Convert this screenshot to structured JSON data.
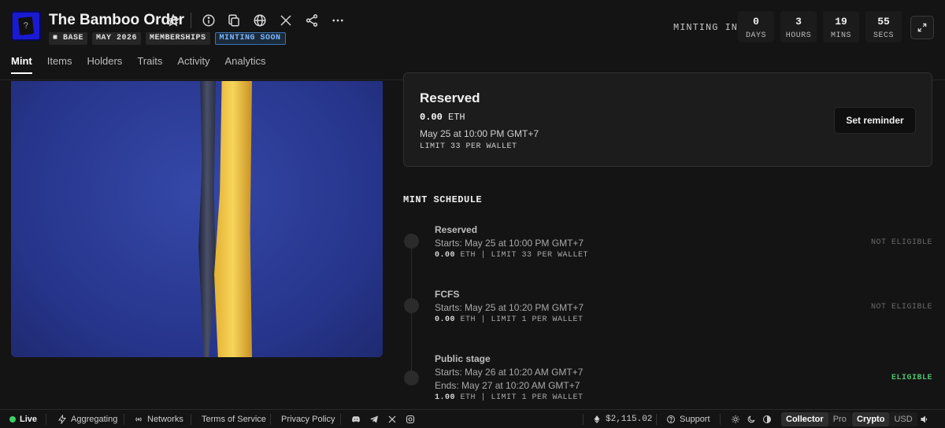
{
  "collection": {
    "title": "The Bamboo Order",
    "logo_glyph": "?",
    "badges": [
      {
        "label": "■ BASE"
      },
      {
        "label": "MAY 2026"
      },
      {
        "label": "MEMBERSHIPS"
      },
      {
        "label": "MINTING SOON"
      }
    ]
  },
  "header_icons": [
    "star-icon",
    "info-icon",
    "copy-icon",
    "globe-icon",
    "x-icon",
    "share-icon",
    "more-icon"
  ],
  "countdown": {
    "label": "MINTING IN",
    "units": [
      {
        "value": "0",
        "label": "DAYS"
      },
      {
        "value": "3",
        "label": "HOURS"
      },
      {
        "value": "19",
        "label": "MINS"
      },
      {
        "value": "55",
        "label": "SECS"
      }
    ]
  },
  "tabs": [
    {
      "label": "Mint",
      "active": true
    },
    {
      "label": "Items"
    },
    {
      "label": "Holders"
    },
    {
      "label": "Traits"
    },
    {
      "label": "Activity"
    },
    {
      "label": "Analytics"
    }
  ],
  "current_stage": {
    "title": "Reserved",
    "price": "0.00",
    "currency": "ETH",
    "date": "May 25 at 10:00 PM GMT+7",
    "limit": "LIMIT 33 PER WALLET",
    "button": "Set reminder"
  },
  "schedule": {
    "title": "MINT SCHEDULE",
    "stages": [
      {
        "name": "Reserved",
        "lines": [
          "Starts: May 25 at 10:00 PM GMT+7"
        ],
        "price": "0.00",
        "detail": "ETH | LIMIT 33 PER WALLET",
        "status": "NOT ELIGIBLE"
      },
      {
        "name": "FCFS",
        "lines": [
          "Starts: May 25 at 10:20 PM GMT+7"
        ],
        "price": "0.00",
        "detail": "ETH | LIMIT 1 PER WALLET",
        "status": "NOT ELIGIBLE"
      },
      {
        "name": "Public stage",
        "lines": [
          "Starts: May 26 at 10:20 AM GMT+7",
          "Ends: May 27 at 10:20 AM GMT+7"
        ],
        "price": "1.00",
        "detail": "ETH | LIMIT 1 PER WALLET",
        "status": "ELIGIBLE"
      }
    ]
  },
  "footer": {
    "live": "Live",
    "aggregating": "Aggregating",
    "networks": "Networks",
    "terms": "Terms of Service",
    "privacy": "Privacy Policy",
    "eth_price": "$2,115.02",
    "support": "Support",
    "mode_options": [
      "Collector",
      "Pro"
    ],
    "currency_options": [
      "Crypto",
      "USD"
    ]
  },
  "colors": {
    "accent_blue": "#3b74b5",
    "eligible_green": "#4cc26a",
    "art_background": "#2b3d97",
    "art_gold": "#f7d45a"
  }
}
